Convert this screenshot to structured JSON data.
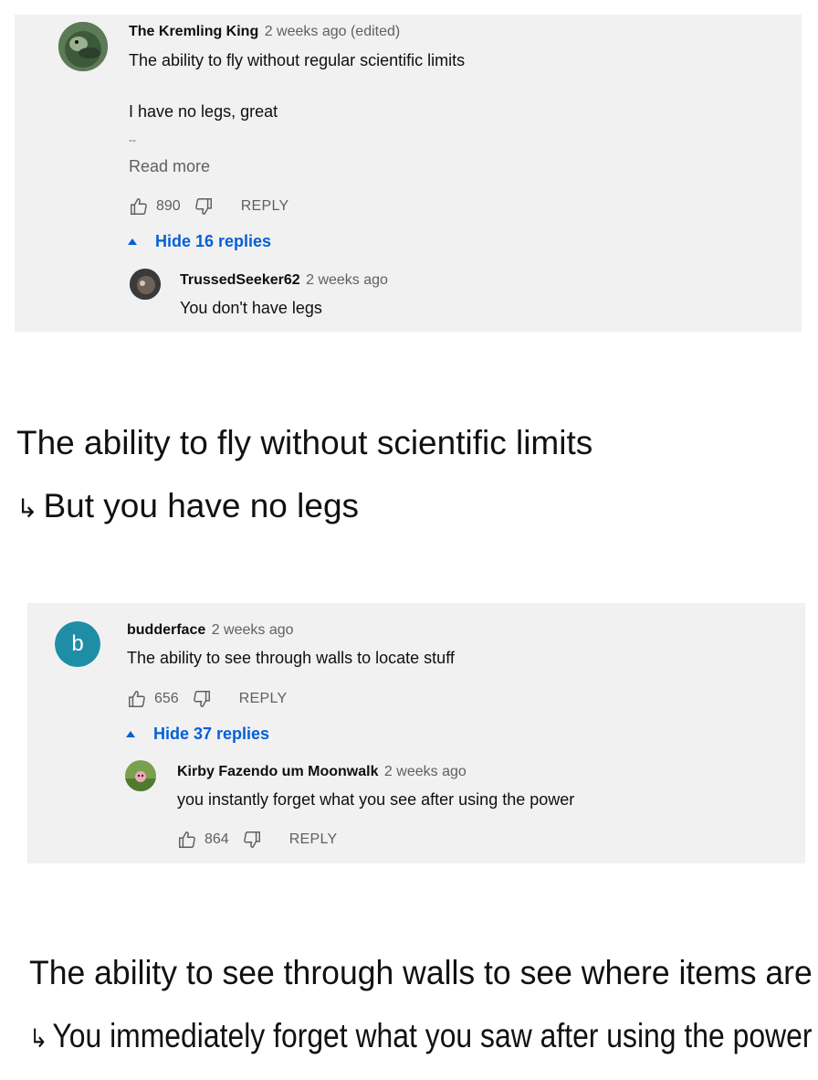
{
  "comment1": {
    "author": "The Kremling King",
    "time": "2 weeks ago (edited)",
    "line1": "The ability to fly without regular scientific limits",
    "line2": "I have no legs, great",
    "dots": "--",
    "read_more": "Read more",
    "likes": "890",
    "reply_label": "REPLY",
    "hide_replies": "Hide 16 replies",
    "reply": {
      "author": "TrussedSeeker62",
      "time": "2 weeks ago",
      "text": "You don't have legs"
    }
  },
  "caption1": {
    "line1": "The ability to fly without scientific limits",
    "line2": "But you have no legs",
    "arrow": "↳"
  },
  "comment2": {
    "avatar_letter": "b",
    "avatar_color": "#1e8ea6",
    "author": "budderface",
    "time": "2 weeks ago",
    "text": "The ability to see through walls to locate stuff",
    "likes": "656",
    "reply_label": "REPLY",
    "hide_replies": "Hide 37 replies",
    "reply": {
      "author": "Kirby Fazendo um Moonwalk",
      "time": "2 weeks ago",
      "text": "you instantly forget what you see after using the power",
      "likes": "864",
      "reply_label": "REPLY"
    }
  },
  "caption2": {
    "line1": "The ability to see through walls to see where items are",
    "line2": "You immediately forget what you saw after using the power",
    "arrow": "↳"
  },
  "colors": {
    "panel_bg": "#f1f1f1",
    "link_blue": "#065fd4",
    "meta_gray": "#606060"
  },
  "icons": [
    "thumbs-up-icon",
    "thumbs-down-icon",
    "caret-up-icon"
  ]
}
